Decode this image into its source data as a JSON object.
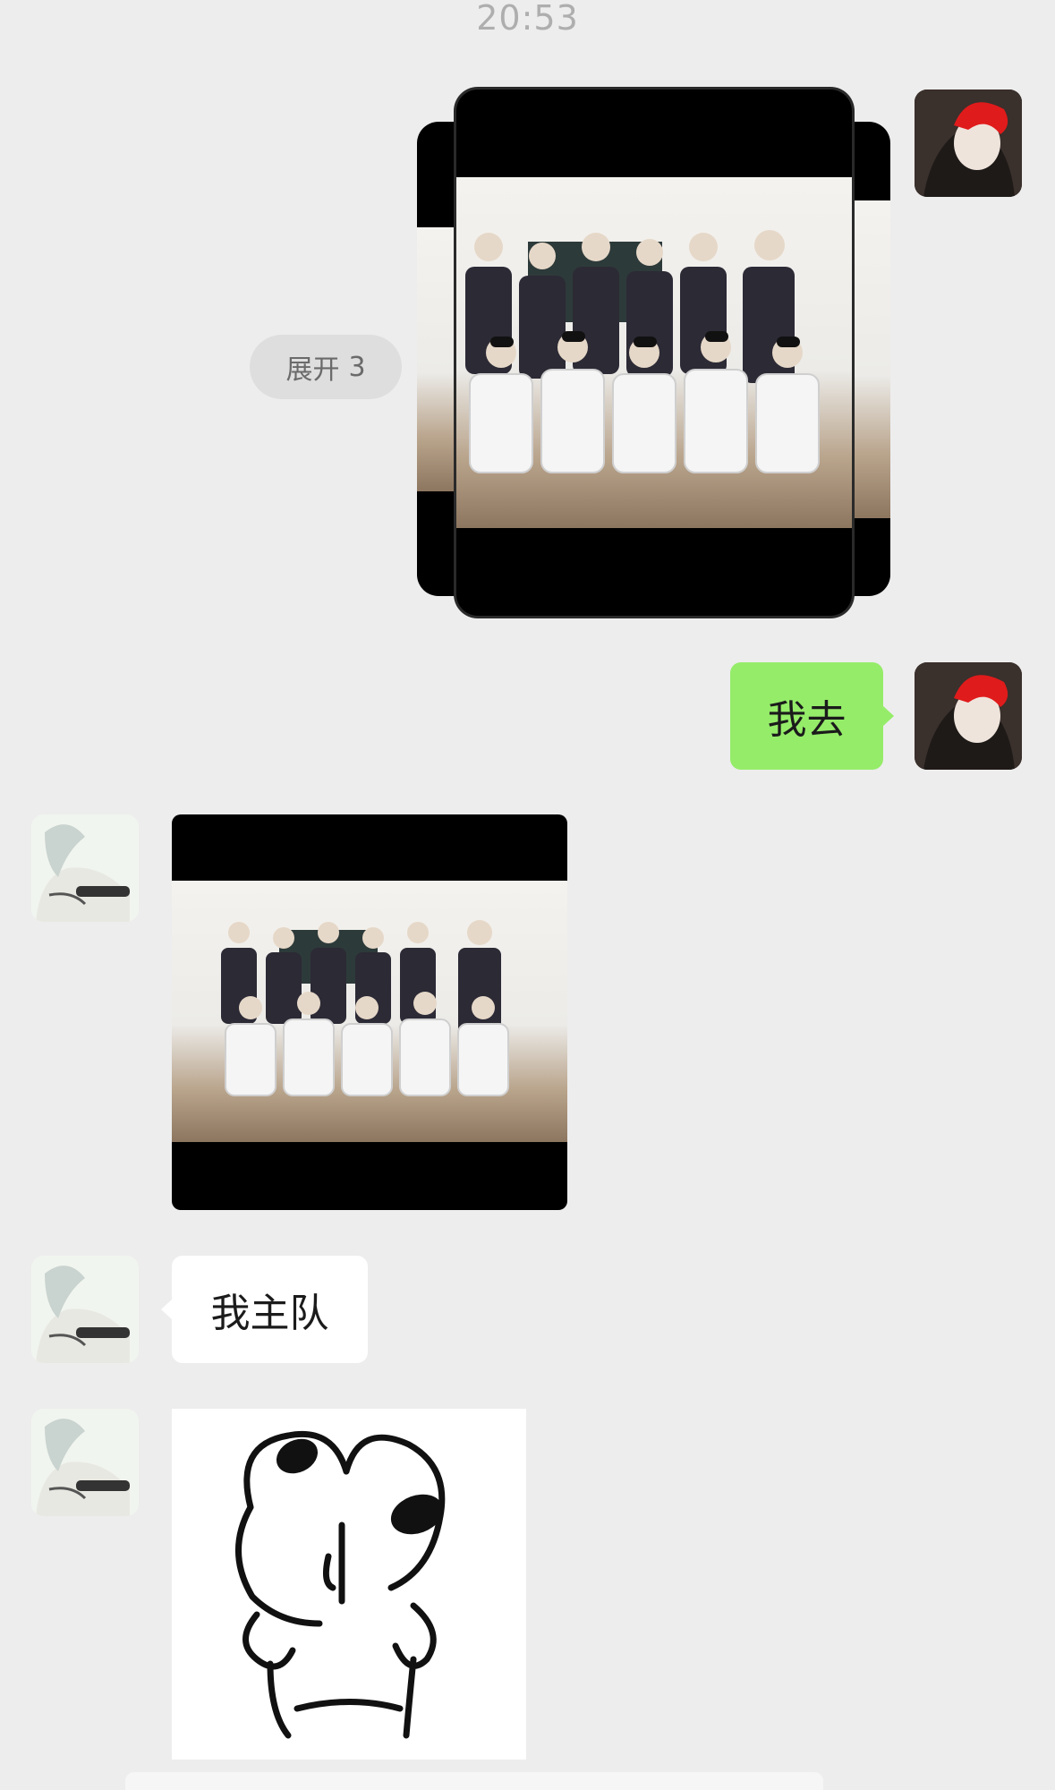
{
  "chat": {
    "timestamp": "20:53",
    "expand_label": "展开",
    "expand_count": "3",
    "messages": [
      {
        "from": "self",
        "type": "image-stack",
        "stack_count": 3
      },
      {
        "from": "self",
        "type": "text",
        "text": "我去"
      },
      {
        "from": "friend",
        "type": "image"
      },
      {
        "from": "friend",
        "type": "text",
        "text": "我主队"
      },
      {
        "from": "friend",
        "type": "sticker"
      }
    ]
  },
  "avatars": {
    "self": {
      "icon": "avatar-red-hair-icon"
    },
    "friend": {
      "icon": "avatar-anime-icon"
    }
  },
  "colors": {
    "background": "#ededed",
    "sent_bubble": "#95ec69",
    "received_bubble": "#ffffff",
    "expand_pill": "#dedede"
  }
}
